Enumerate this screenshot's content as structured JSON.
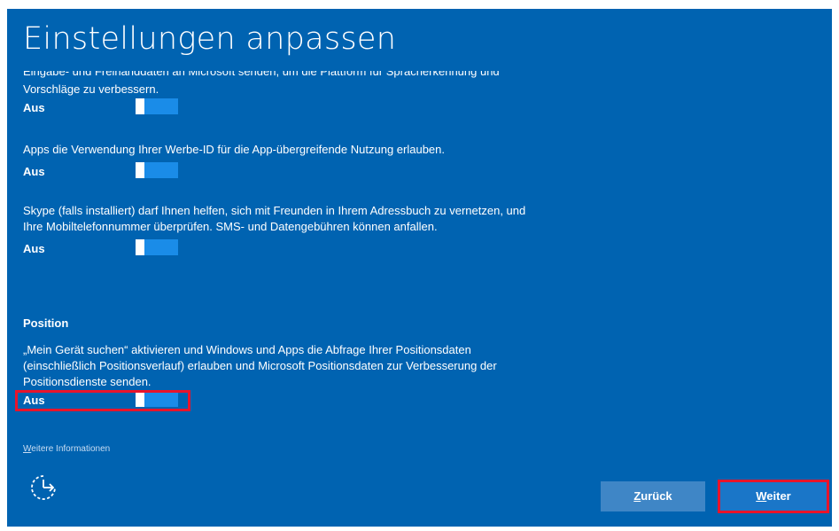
{
  "window": {
    "title": "Einstellungen anpassen"
  },
  "settings": {
    "cut_text": "Eingabe- und Freihanddaten an Microsoft senden, um die Plattform für Spracherkennung und",
    "items": [
      {
        "description_lines": [
          "Vorschläge zu verbessern."
        ],
        "state_label": "Aus",
        "toggle_on": false
      },
      {
        "description_lines": [
          "Apps die Verwendung Ihrer Werbe-ID für die App-übergreifende Nutzung erlauben."
        ],
        "state_label": "Aus",
        "toggle_on": false
      },
      {
        "description_lines": [
          "Skype (falls installiert) darf Ihnen helfen, sich mit Freunden in Ihrem Adressbuch zu vernetzen, und",
          "Ihre Mobiltelefonnummer überprüfen. SMS- und Datengebühren können anfallen."
        ],
        "state_label": "Aus",
        "toggle_on": false
      }
    ],
    "position_section": {
      "heading": "Position",
      "description_lines": [
        "„Mein Gerät suchen“ aktivieren und Windows und Apps die Abfrage Ihrer Positionsdaten",
        "(einschließlich Positionsverlauf) erlauben und Microsoft Positionsdaten zur Verbesserung der",
        "Positionsdienste senden."
      ],
      "state_label": "Aus",
      "toggle_on": false
    }
  },
  "footer": {
    "more_info_accel": "W",
    "more_info_rest": "eitere Informationen",
    "accessibility_icon": "ease-of-access-icon",
    "back_accel": "Z",
    "back_rest": "urück",
    "next_accel": "W",
    "next_rest": "eiter"
  },
  "colors": {
    "background": "#0063b1",
    "toggle_track": "#1a8ce8",
    "highlight": "#e8142b",
    "back_button": "#3f86c6",
    "next_button": "#1a76c8"
  }
}
